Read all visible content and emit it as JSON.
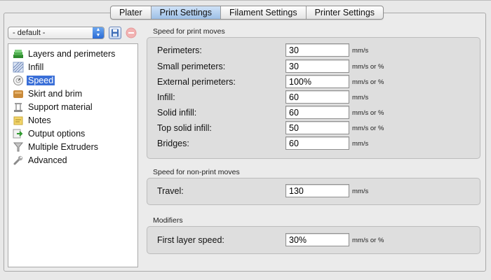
{
  "tabs": [
    {
      "label": "Plater",
      "active": false
    },
    {
      "label": "Print Settings",
      "active": true
    },
    {
      "label": "Filament Settings",
      "active": false
    },
    {
      "label": "Printer Settings",
      "active": false
    }
  ],
  "preset": {
    "value": "- default -"
  },
  "sidebar": {
    "items": [
      {
        "label": "Layers and perimeters",
        "icon": "layers-icon"
      },
      {
        "label": "Infill",
        "icon": "infill-icon"
      },
      {
        "label": "Speed",
        "icon": "speed-icon",
        "selected": true
      },
      {
        "label": "Skirt and brim",
        "icon": "skirt-icon"
      },
      {
        "label": "Support material",
        "icon": "support-icon"
      },
      {
        "label": "Notes",
        "icon": "notes-icon"
      },
      {
        "label": "Output options",
        "icon": "output-icon"
      },
      {
        "label": "Multiple Extruders",
        "icon": "extruder-icon"
      },
      {
        "label": "Advanced",
        "icon": "wrench-icon"
      }
    ]
  },
  "groups": {
    "print_moves": {
      "title": "Speed for print moves",
      "fields": [
        {
          "label": "Perimeters:",
          "value": "30",
          "unit": "mm/s"
        },
        {
          "label": "Small perimeters:",
          "value": "30",
          "unit": "mm/s or %"
        },
        {
          "label": "External perimeters:",
          "value": "100%",
          "unit": "mm/s or %"
        },
        {
          "label": "Infill:",
          "value": "60",
          "unit": "mm/s"
        },
        {
          "label": "Solid infill:",
          "value": "60",
          "unit": "mm/s or %"
        },
        {
          "label": "Top solid infill:",
          "value": "50",
          "unit": "mm/s or %"
        },
        {
          "label": "Bridges:",
          "value": "60",
          "unit": "mm/s"
        }
      ]
    },
    "non_print_moves": {
      "title": "Speed for non-print moves",
      "fields": [
        {
          "label": "Travel:",
          "value": "130",
          "unit": "mm/s"
        }
      ]
    },
    "modifiers": {
      "title": "Modifiers",
      "fields": [
        {
          "label": "First layer speed:",
          "value": "30%",
          "unit": "mm/s or %"
        }
      ]
    }
  },
  "colors": {
    "selection": "#3a6fd8",
    "active_tab": "#b3cff0"
  }
}
